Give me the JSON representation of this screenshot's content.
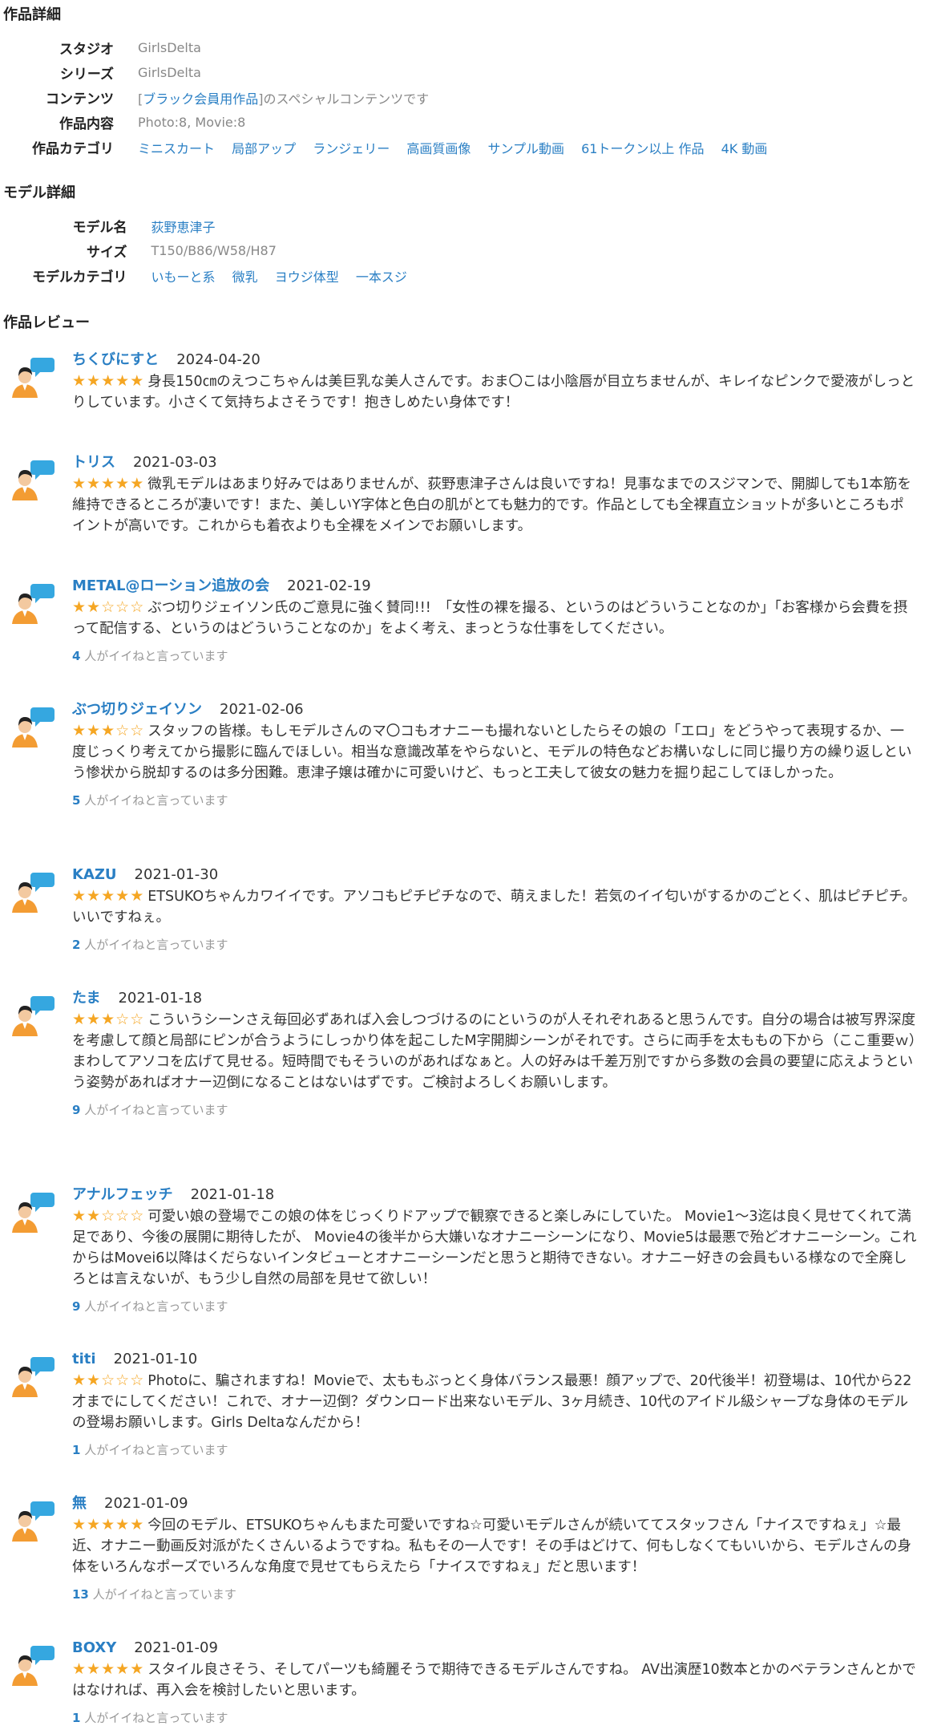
{
  "work": {
    "heading": "作品詳細",
    "rows": [
      {
        "label": "スタジオ",
        "value": "GirlsDelta"
      },
      {
        "label": "シリーズ",
        "value": "GirlsDelta"
      },
      {
        "label": "コンテンツ",
        "link": "ブラック会員用作品",
        "prefix": "[",
        "suffix": "]のスペシャルコンテンツです"
      },
      {
        "label": "作品内容",
        "value": "Photo:8, Movie:8"
      },
      {
        "label": "作品カテゴリ",
        "tags": [
          "ミニスカート",
          "局部アップ",
          "ランジェリー",
          "高画質画像",
          "サンプル動画",
          "61トークン以上 作品",
          "4K 動画"
        ]
      }
    ]
  },
  "model": {
    "heading": "モデル詳細",
    "name_label": "モデル名",
    "name": "荻野恵津子",
    "size_label": "サイズ",
    "size": "T150/B86/W58/H87",
    "cat_label": "モデルカテゴリ",
    "tags": [
      "いもーと系",
      "微乳",
      "ヨウジ体型",
      "一本スジ"
    ]
  },
  "reviews_heading": "作品レビュー",
  "likes_suffix": " 人がイイねと言っています",
  "colors": {
    "link": "#2a7fc4",
    "star": "#f5a623",
    "avatar_body": "#f39c33",
    "bubble": "#35a7e0"
  },
  "reviews": [
    {
      "name": "ちくびにすと",
      "date": "2024-04-20",
      "stars": 5,
      "text": "身長150㎝のえつこちゃんは美巨乳な美人さんです。おま〇こは小陰唇が目立ちませんが、キレイなピンクで愛液がしっとりしています。小さくて気持ちよさそうです！抱きしめたい身体です！",
      "likes": null
    },
    {
      "name": "トリス",
      "date": "2021-03-03",
      "stars": 5,
      "text": "微乳モデルはあまり好みではありませんが、荻野恵津子さんは良いですね！見事なまでのスジマンで、開脚しても1本筋を維持できるところが凄いです！また、美しいY字体と色白の肌がとても魅力的です。作品としても全裸直立ショットが多いところもポイントが高いです。これからも着衣よりも全裸をメインでお願いします。",
      "likes": null
    },
    {
      "name": "METAL@ローション追放の会",
      "date": "2021-02-19",
      "stars": 2,
      "text": "ぶつ切りジェイソン氏のご意見に強く賛同!!!　「女性の裸を撮る、というのはどういうことなのか」「お客様から会費を摂って配信する、というのはどういうことなのか」をよく考え、まっとうな仕事をしてください。",
      "likes": "4"
    },
    {
      "name": "ぶつ切りジェイソン",
      "date": "2021-02-06",
      "stars": 3,
      "text": "スタッフの皆様。もしモデルさんのマ〇コもオナニーも撮れないとしたらその娘の「エロ」をどうやって表現するか、一度じっくり考えてから撮影に臨んでほしい。相当な意識改革をやらないと、モデルの特色などお構いなしに同じ撮り方の繰り返しという惨状から脱却するのは多分困難。恵津子嬢は確かに可愛いけど、もっと工夫して彼女の魅力を掘り起こしてほしかった。",
      "likes": "5"
    },
    {
      "name": "KAZU",
      "date": "2021-01-30",
      "stars": 5,
      "text": "ETSUKOちゃんカワイイです。アソコもピチピチなので、萌えました！若気のイイ匂いがするかのごとく、肌はピチピチ。いいですねぇ。",
      "likes": "2"
    },
    {
      "name": "たま",
      "date": "2021-01-18",
      "stars": 3,
      "text": "こういうシーンさえ毎回必ずあれば入会しつづけるのにというのが人それぞれあると思うんです。自分の場合は被写界深度を考慮して顔と局部にピンが合うようにしっかり体を起こしたM字開脚シーンがそれです。さらに両手を太ももの下から（ここ重要ｗ）まわしてアソコを広げて見せる。短時間でもそういのがあればなぁと。人の好みは千差万別ですから多数の会員の要望に応えようという姿勢があればオナー辺倒になることはないはずです。ご検討よろしくお願いします。",
      "likes": "9"
    },
    {
      "name": "アナルフェッチ",
      "date": "2021-01-18",
      "stars": 2,
      "text": "可愛い娘の登場でこの娘の体をじっくりドアップで観察できると楽しみにしていた。 Movie1～3迄は良く見せてくれて満足であり、今後の展開に期待したが、 Movie4の後半から大嫌いなオナニーシーンになり、Movie5は最悪で殆どオナニーシーン。これからはMovei6以降はくだらないインタビューとオナニーシーンだと思うと期待できない。オナニー好きの会員もいる様なので全廃しろとは言えないが、もう少し自然の局部を見せて欲しい！",
      "likes": "9"
    },
    {
      "name": "titi",
      "date": "2021-01-10",
      "stars": 2,
      "text": "Photoに、騙されますね！Movieで、太ももぶっとく身体バランス最悪！顔アップで、20代後半！初登場は、10代から22才までにしてください！これで、オナー辺倒？ダウンロード出来ないモデル、3ヶ月続き、10代のアイドル級シャープな身体のモデルの登場お願いします。Girls Deltaなんだから！",
      "likes": "1"
    },
    {
      "name": "無",
      "date": "2021-01-09",
      "stars": 5,
      "text": "今回のモデル、ETSUKOちゃんもまた可愛いですね☆可愛いモデルさんが続いててスタッフさん「ナイスですねぇ」☆最近、オナニー動画反対派がたくさんいるようですね。私もその一人です！その手はどけて、何もしなくてもいいから、モデルさんの身体をいろんなポーズでいろんな角度で見せてもらえたら「ナイスですねぇ」だと思います！",
      "likes": "13"
    },
    {
      "name": "BOXY",
      "date": "2021-01-09",
      "stars": 5,
      "text": "スタイル良さそう、そしてパーツも綺麗そうで期待できるモデルさんですね。 AV出演歴10数本とかのベテランさんとかではなければ、再入会を検討したいと思います。",
      "likes": "1"
    }
  ]
}
